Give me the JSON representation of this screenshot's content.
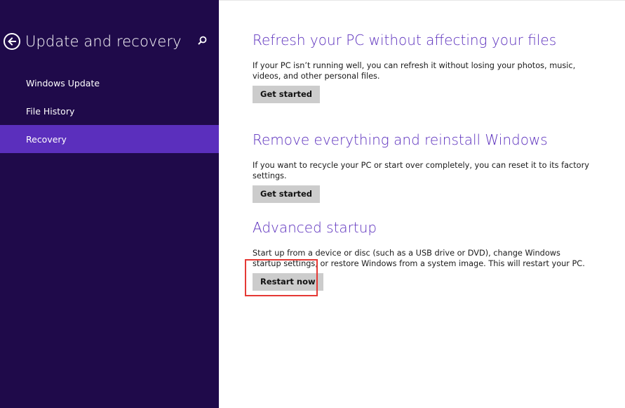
{
  "sidebar": {
    "title": "Update and recovery",
    "back_icon": "back-arrow-circle-icon",
    "search_icon": "search-icon",
    "items": [
      {
        "label": "Windows Update",
        "active": false
      },
      {
        "label": "File History",
        "active": false
      },
      {
        "label": "Recovery",
        "active": true
      }
    ]
  },
  "main": {
    "sections": [
      {
        "heading": "Refresh your PC without affecting your files",
        "description": "If your PC isn’t running well, you can refresh it without losing your photos, music, videos, and other personal files.",
        "button_label": "Get started"
      },
      {
        "heading": "Remove everything and reinstall Windows",
        "description": "If you want to recycle your PC or start over completely, you can reset it to its factory settings.",
        "button_label": "Get started"
      },
      {
        "heading": "Advanced startup",
        "description": "Start up from a device or disc (such as a USB drive or DVD), change Windows startup settings, or restore Windows from a system image. This will restart your PC.",
        "button_label": "Restart now"
      }
    ]
  },
  "colors": {
    "sidebar_bg": "#1f0a4a",
    "accent": "#5b2fbd",
    "button_bg": "#cccccc",
    "highlight": "#e53935"
  }
}
